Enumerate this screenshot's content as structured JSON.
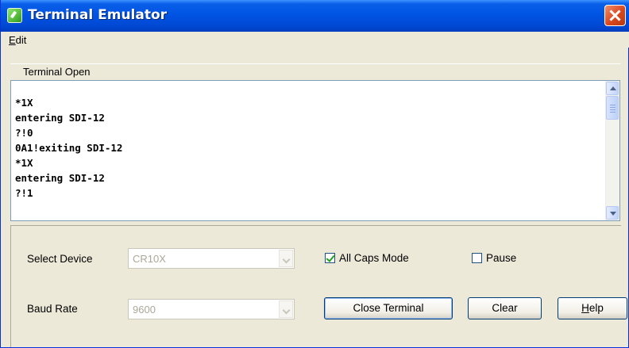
{
  "window": {
    "title": "Terminal Emulator"
  },
  "menu": {
    "edit_label": "Edit"
  },
  "status": {
    "text": "Terminal Open"
  },
  "terminal": {
    "lines": [
      "*1X",
      "entering SDI-12",
      "?!0",
      "0A1!exiting SDI-12",
      "*1X",
      "entering SDI-12",
      "?!1"
    ]
  },
  "controls": {
    "select_device_label": "Select Device",
    "select_device_value": "CR10X",
    "baud_rate_label": "Baud Rate",
    "baud_rate_value": "9600",
    "all_caps_label": "All Caps Mode",
    "all_caps_checked": true,
    "pause_label": "Pause",
    "pause_checked": false,
    "close_terminal_label": "Close Terminal",
    "clear_label": "Clear",
    "help_label": "Help"
  },
  "colors": {
    "titlebar": "#0054E3",
    "close_button": "#D8471E",
    "window_bg": "#ECE9D8",
    "checkmark": "#21A121"
  }
}
